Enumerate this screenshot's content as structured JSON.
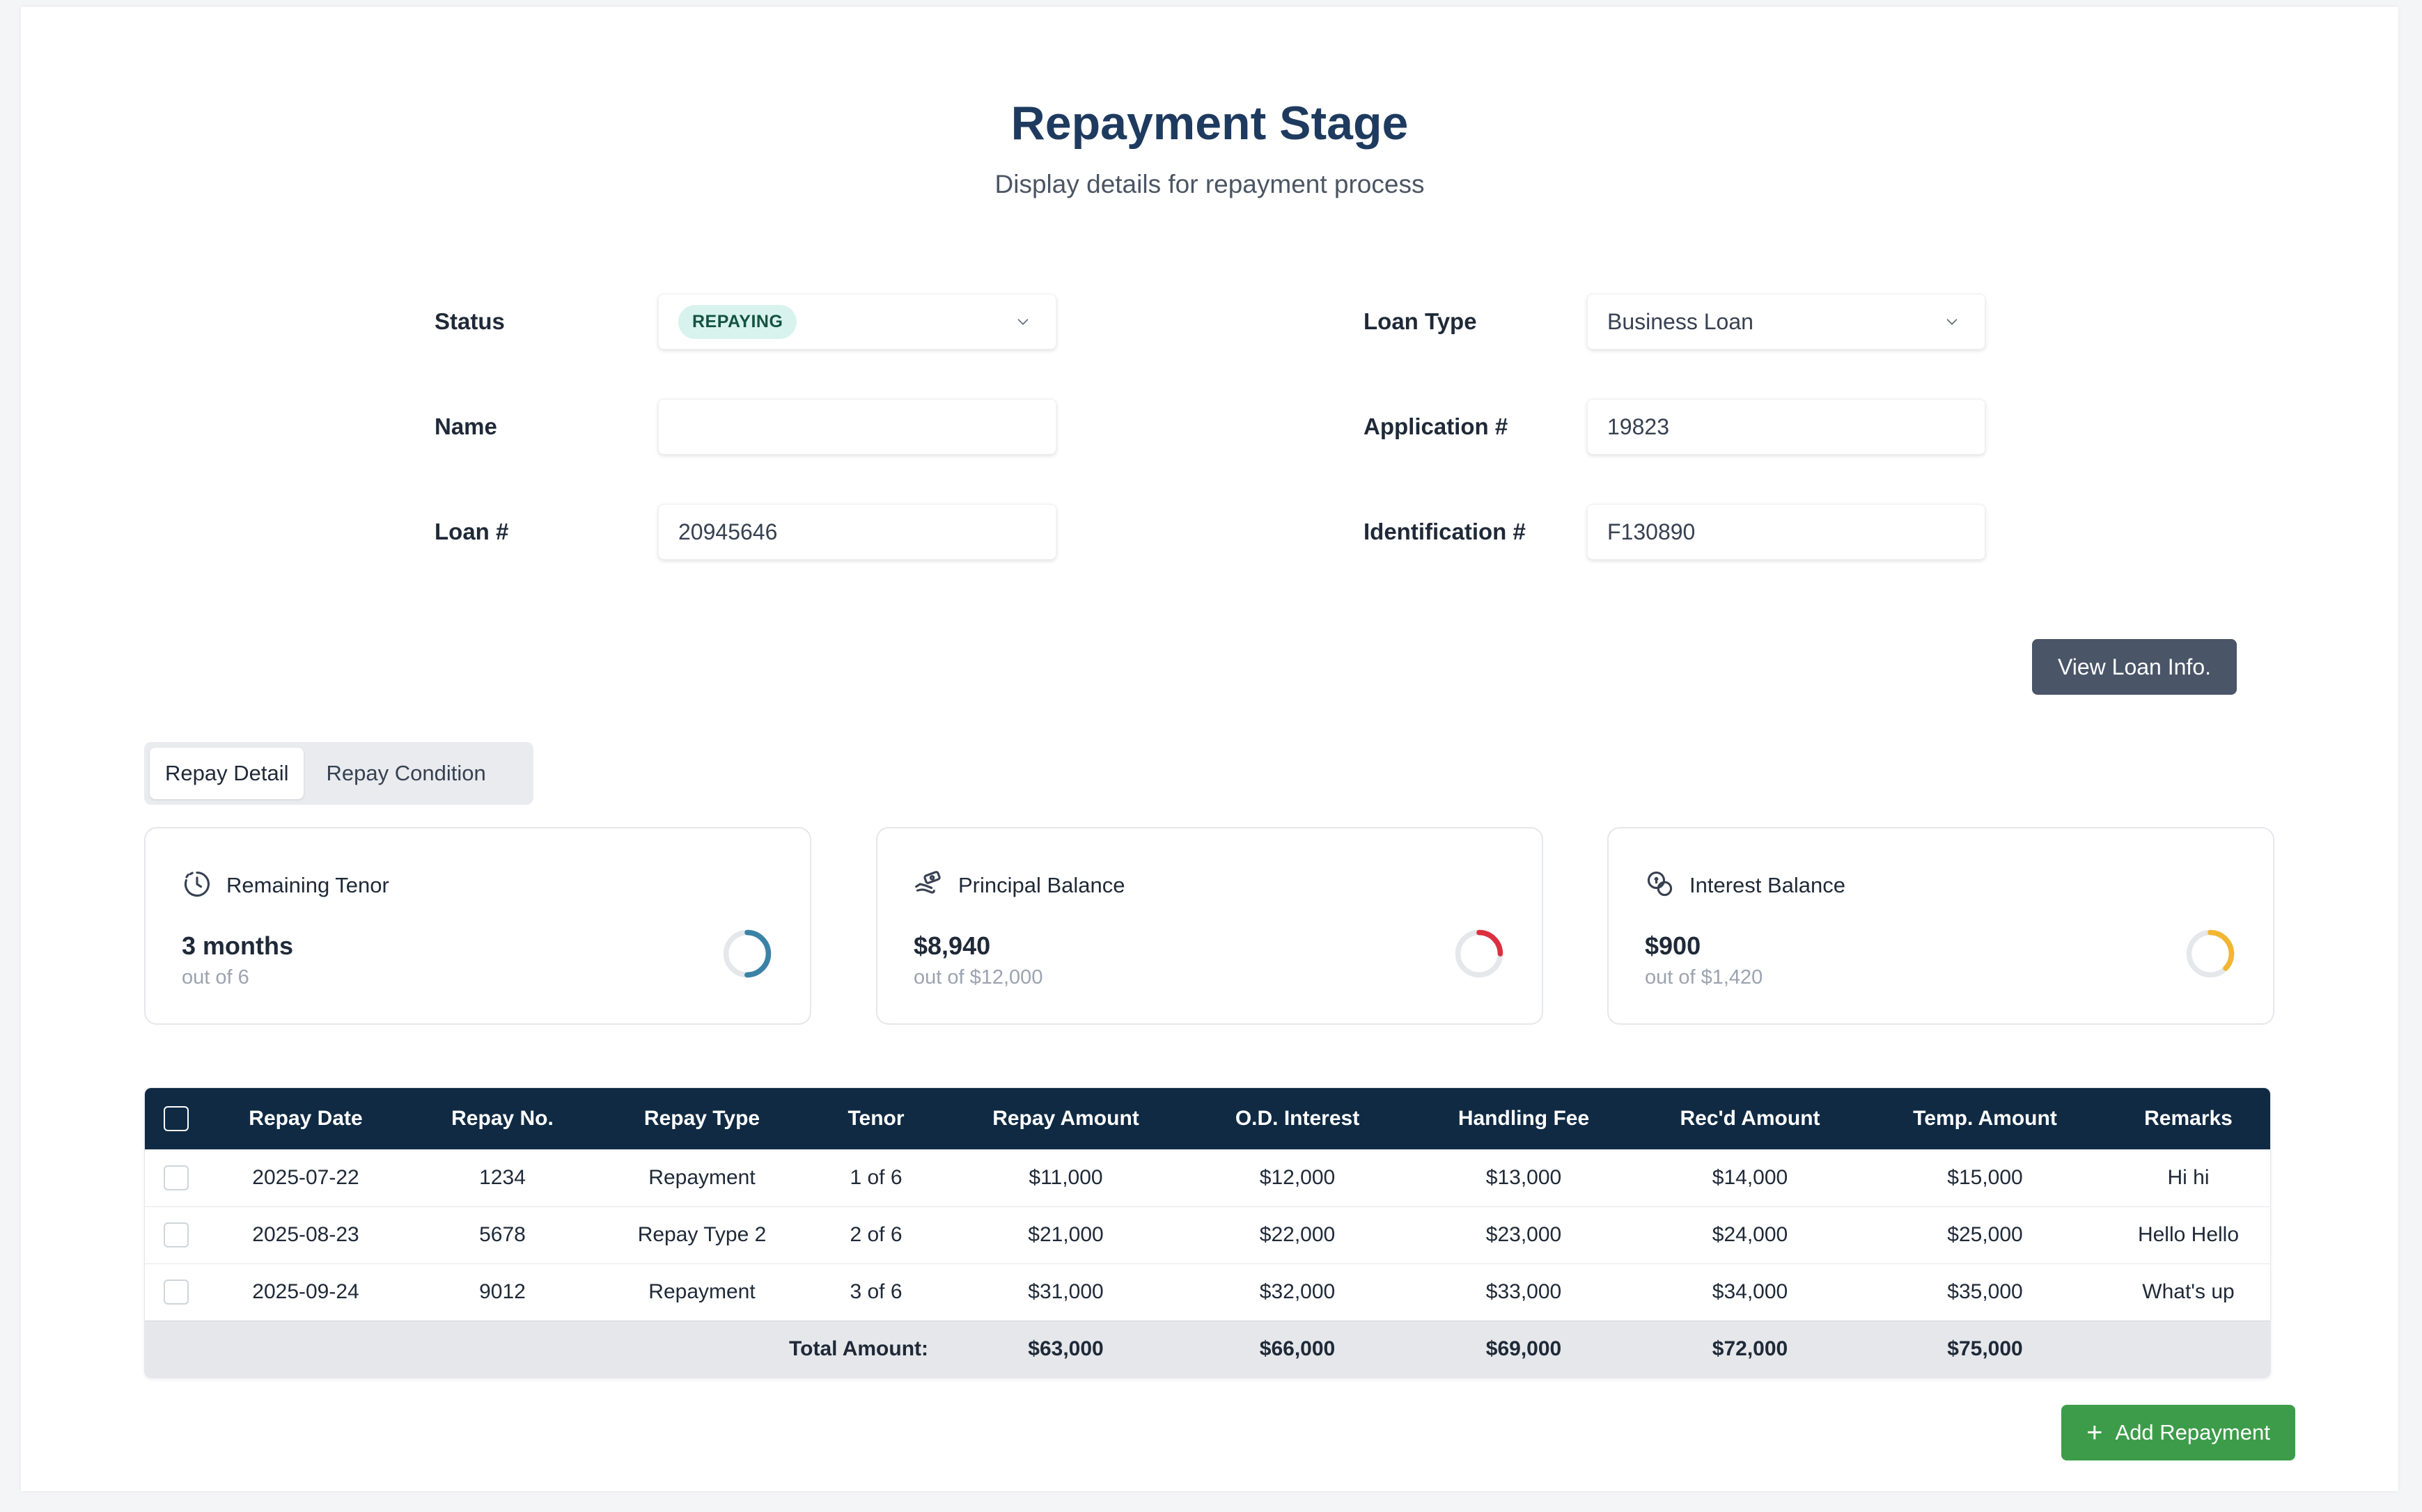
{
  "header": {
    "title": "Repayment Stage",
    "subtitle": "Display details for repayment process"
  },
  "form": {
    "status": {
      "label": "Status",
      "value": "REPAYING"
    },
    "loan_type": {
      "label": "Loan Type",
      "value": "Business Loan"
    },
    "name": {
      "label": "Name",
      "value": ""
    },
    "application_no": {
      "label": "Application #",
      "value": "19823"
    },
    "loan_no": {
      "label": "Loan #",
      "value": "20945646"
    },
    "identification_no": {
      "label": "Identification #",
      "value": "F130890"
    }
  },
  "view_button": "View Loan Info.",
  "tabs": [
    {
      "label": "Repay Detail",
      "active": true
    },
    {
      "label": "Repay Condition",
      "active": false
    }
  ],
  "cards": [
    {
      "title": "Remaining Tenor",
      "value": "3 months",
      "sub": "out of 6",
      "icon": "clock-icon",
      "color": "#3b82a6",
      "progress": 0.5
    },
    {
      "title": "Principal Balance",
      "value": "$8,940",
      "sub": "out of $12,000",
      "icon": "money-hand-icon",
      "color": "#dc2f3f",
      "progress": 0.25
    },
    {
      "title": "Interest Balance",
      "value": "$900",
      "sub": "out of $1,420",
      "icon": "coins-icon",
      "color": "#f2b632",
      "progress": 0.37
    }
  ],
  "table": {
    "headers": [
      "Repay Date",
      "Repay No.",
      "Repay Type",
      "Tenor",
      "Repay Amount",
      "O.D. Interest",
      "Handling Fee",
      "Rec'd Amount",
      "Temp. Amount",
      "Remarks"
    ],
    "rows": [
      [
        "2025-07-22",
        "1234",
        "Repayment",
        "1 of 6",
        "$11,000",
        "$12,000",
        "$13,000",
        "$14,000",
        "$15,000",
        "Hi hi"
      ],
      [
        "2025-08-23",
        "5678",
        "Repay Type 2",
        "2 of 6",
        "$21,000",
        "$22,000",
        "$23,000",
        "$24,000",
        "$25,000",
        "Hello Hello"
      ],
      [
        "2025-09-24",
        "9012",
        "Repayment",
        "3 of 6",
        "$31,000",
        "$32,000",
        "$33,000",
        "$34,000",
        "$35,000",
        "What's up"
      ]
    ],
    "total_label": "Total Amount:",
    "totals": [
      "$63,000",
      "$66,000",
      "$69,000",
      "$72,000",
      "$75,000"
    ]
  },
  "add_button": "Add Repayment"
}
